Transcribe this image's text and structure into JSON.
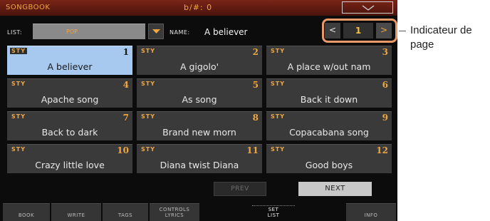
{
  "titlebar": {
    "app": "SONGBOOK",
    "key": "b/#: 0"
  },
  "list": {
    "label": "LIST:",
    "value": "POP"
  },
  "name": {
    "label": "NAME:",
    "value": "A believer"
  },
  "pager": {
    "prev": "<",
    "page": "1",
    "next": ">"
  },
  "cells": [
    {
      "tag": "STY",
      "num": "1",
      "title": "A believer"
    },
    {
      "tag": "STY",
      "num": "2",
      "title": "A gigolo'"
    },
    {
      "tag": "STY",
      "num": "3",
      "title": "A place w/out nam"
    },
    {
      "tag": "STY",
      "num": "4",
      "title": "Apache song"
    },
    {
      "tag": "STY",
      "num": "5",
      "title": "As song"
    },
    {
      "tag": "STY",
      "num": "6",
      "title": "Back it down"
    },
    {
      "tag": "STY",
      "num": "7",
      "title": "Back to dark"
    },
    {
      "tag": "STY",
      "num": "8",
      "title": "Brand new morn"
    },
    {
      "tag": "STY",
      "num": "9",
      "title": "Copacabana song"
    },
    {
      "tag": "STY",
      "num": "10",
      "title": "Crazy little love"
    },
    {
      "tag": "STY",
      "num": "11",
      "title": "Diana twist Diana"
    },
    {
      "tag": "STY",
      "num": "12",
      "title": "Good boys"
    }
  ],
  "buttons": {
    "prev": "PREV",
    "next": "NEXT"
  },
  "tabs": [
    {
      "label": "BOOK"
    },
    {
      "label": "WRITE"
    },
    {
      "label": "TAGS"
    },
    {
      "label": "CONTROLS\nLYRICS"
    },
    {
      "label": "SET\nLIST"
    },
    {
      "label": "INFO"
    }
  ],
  "callout": "Indicateur de page",
  "colors": {
    "accent": "#f0a640",
    "selected": "#a7c9ef",
    "title_bar": "#6a1f14",
    "highlight_ring": "#e89a68"
  }
}
